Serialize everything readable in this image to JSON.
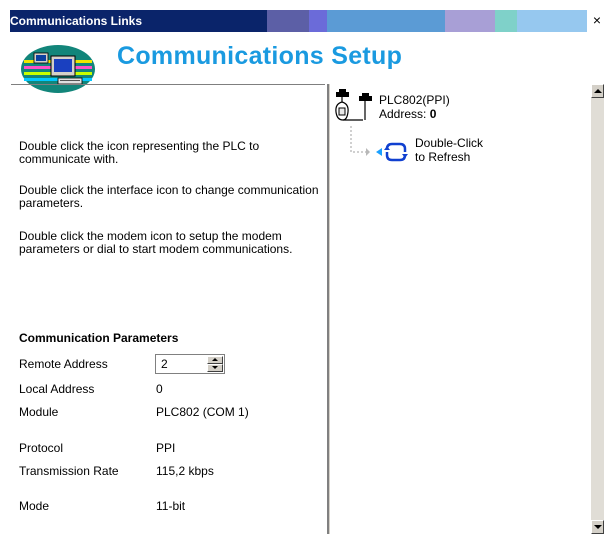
{
  "window": {
    "title": "Communications Links",
    "close_glyph": "×"
  },
  "header": {
    "title": "Communications Setup",
    "logo_icon": "network-computer-icon"
  },
  "instructions": [
    "Double click the icon representing the PLC to communicate with.",
    "Double click the interface icon to change communication parameters.",
    "Double click the modem icon to setup the modem parameters or dial to start modem communications."
  ],
  "params": {
    "title": "Communication Parameters",
    "remote_address": {
      "label": "Remote Address",
      "value": "2"
    },
    "local_address": {
      "label": "Local Address",
      "value": "0"
    },
    "module": {
      "label": "Module",
      "value": "PLC802 (COM 1)"
    },
    "protocol": {
      "label": "Protocol",
      "value": "PPI"
    },
    "transmission_rate": {
      "label": "Transmission Rate",
      "value": "115,2 kbps"
    },
    "mode": {
      "label": "Mode",
      "value": "11-bit"
    }
  },
  "tree": {
    "root": {
      "name": "PLC802(PPI)",
      "address_label": "Address:",
      "address_value": "0",
      "icon": "plc-cable-icon"
    },
    "child": {
      "line1": "Double-Click",
      "line2": "to Refresh",
      "icon": "refresh-icon"
    }
  },
  "colors": {
    "title_blue": "#1a9ae0",
    "titlebar_dark": "#0a246a"
  }
}
